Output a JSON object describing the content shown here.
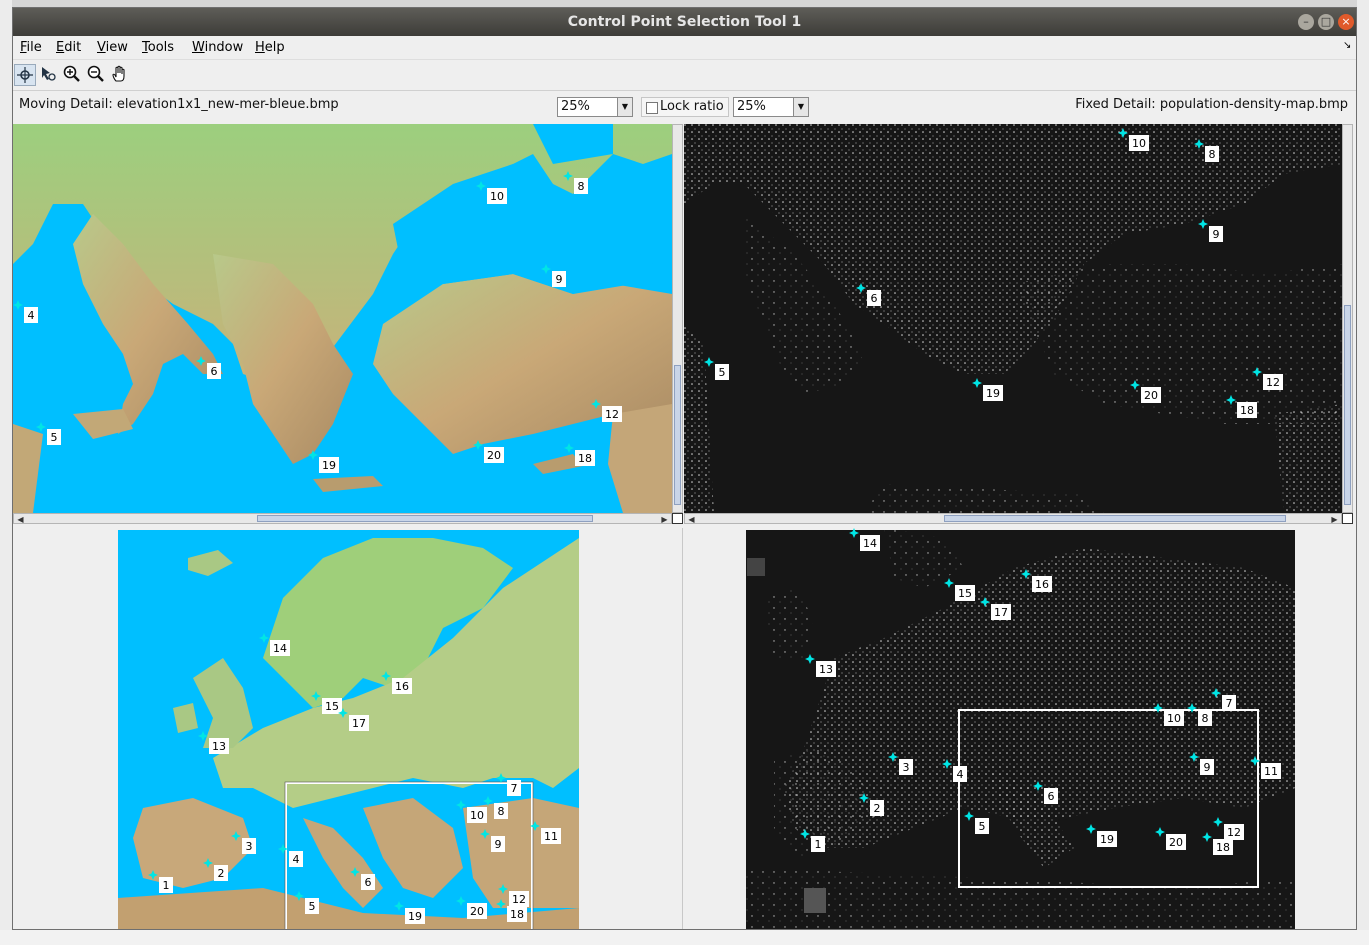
{
  "window": {
    "title": "Control Point Selection Tool 1",
    "controls": [
      "minimize",
      "maximize",
      "close"
    ]
  },
  "menu": {
    "items": [
      {
        "key": "F",
        "rest": "ile"
      },
      {
        "key": "E",
        "rest": "dit"
      },
      {
        "key": "V",
        "rest": "iew"
      },
      {
        "key": "T",
        "rest": "ools"
      },
      {
        "key": "W",
        "rest": "indow"
      },
      {
        "key": "H",
        "rest": "elp"
      }
    ],
    "dock_arrow": "↘"
  },
  "toolbar": {
    "tools": [
      "add-points-icon",
      "select-move-points-icon",
      "zoom-in-icon",
      "zoom-out-icon",
      "pan-hand-icon"
    ],
    "active": "add-points-icon"
  },
  "detail": {
    "moving_label": "Moving Detail: elevation1x1_new-mer-bleue.bmp",
    "fixed_label": "Fixed Detail: population-density-map.bmp",
    "moving_zoom": "25%",
    "fixed_zoom": "25%",
    "lock_ratio_label": "Lock ratio",
    "lock_ratio_checked": false
  },
  "colors": {
    "sea": "#00bfff",
    "point_marker": "#00e5e5",
    "night_bg": "#1a1a1a",
    "detail_rect": "#ffffff"
  },
  "point_labels": {
    "moving_detail": [
      "10",
      "8",
      "9",
      "4",
      "6",
      "5",
      "12",
      "18",
      "20",
      "19"
    ],
    "fixed_detail": [
      "10",
      "8",
      "9",
      "6",
      "5",
      "20",
      "12",
      "18",
      "19"
    ],
    "moving_overview": [
      "14",
      "16",
      "15",
      "17",
      "13",
      "7",
      "10",
      "8",
      "3",
      "4",
      "9",
      "11",
      "1",
      "2",
      "6",
      "5",
      "12",
      "20",
      "18",
      "19"
    ],
    "fixed_overview": [
      "14",
      "16",
      "15",
      "17",
      "13",
      "7",
      "10",
      "8",
      "3",
      "4",
      "9",
      "11",
      "2",
      "6",
      "5",
      "12",
      "1",
      "19",
      "20",
      "18"
    ]
  }
}
